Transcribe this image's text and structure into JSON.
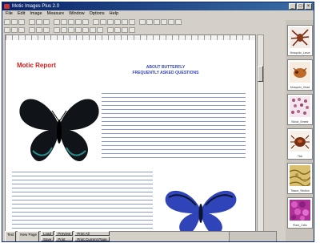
{
  "app": {
    "title": "Motic Images Plus 2.0"
  },
  "menu": [
    "File",
    "Edit",
    "Image",
    "Measure",
    "Window",
    "Options",
    "Help"
  ],
  "document": {
    "title": "Motic Report",
    "faq_heading_line1": "ABOUT BUTTERFLY",
    "faq_heading_line2": "FREQUENTLY ASKED QUESTIONS"
  },
  "bottom_buttons": {
    "text": "Text",
    "new_page": "New Page",
    "load": "Load",
    "save": "Save",
    "preview": "Preview",
    "print": "Print",
    "print_all": "Print All",
    "print_current": "Print Current Page"
  },
  "thumbnails": [
    {
      "label": "Mosquito_Larva",
      "icon": "mosquito-larva"
    },
    {
      "label": "Mosquito_Head",
      "icon": "mosquito-head"
    },
    {
      "label": "Blood_Smear",
      "icon": "blood-smear"
    },
    {
      "label": "Tick",
      "icon": "tick"
    },
    {
      "label": "Tissue_Section",
      "icon": "tissue-section"
    },
    {
      "label": "Plant_Cells",
      "icon": "plant-cells"
    }
  ],
  "colors": {
    "title_red": "#d81b1b",
    "heading_blue": "#3344bb",
    "titlebar": "#0a246a"
  }
}
